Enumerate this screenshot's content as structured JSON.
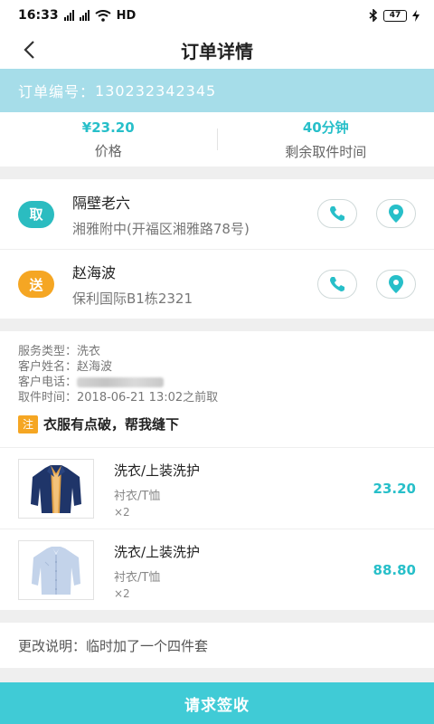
{
  "status_bar": {
    "time": "16:33",
    "network": "HD",
    "battery": "47"
  },
  "header": {
    "title": "订单详情"
  },
  "order": {
    "number_label": "订单编号：",
    "number": "130232342345"
  },
  "stats": {
    "price_value": "¥23.20",
    "price_label": "价格",
    "time_value": "40分钟",
    "time_label": "剩余取件时间"
  },
  "pickup": {
    "badge": "取",
    "name": "隔壁老六",
    "address": "湘雅附中(开福区湘雅路78号)"
  },
  "delivery": {
    "badge": "送",
    "name": "赵海波",
    "address": "保利国际B1栋2321"
  },
  "details": {
    "service_type": "服务类型：洗衣",
    "customer_name": "客户姓名：赵海波",
    "customer_phone_label": "客户电话：",
    "pickup_time": "取件时间：2018-06-21 13:02之前取"
  },
  "note": {
    "tag": "注",
    "text": "衣服有点破，帮我缝下"
  },
  "items": [
    {
      "name": "洗衣/上装洗护",
      "sub": "衬衣/T恤",
      "qty": "×2",
      "price": "23.20"
    },
    {
      "name": "洗衣/上装洗护",
      "sub": "衬衣/T恤",
      "qty": "×2",
      "price": "88.80"
    }
  ],
  "change_note": "更改说明：临时加了一个四件套",
  "submit_label": "请求签收",
  "colors": {
    "accent": "#27bfc9",
    "order_bar": "#a6dde9",
    "pickup_badge": "#2bbcc0",
    "delivery_badge": "#f5a623",
    "submit": "#40cbd6"
  }
}
